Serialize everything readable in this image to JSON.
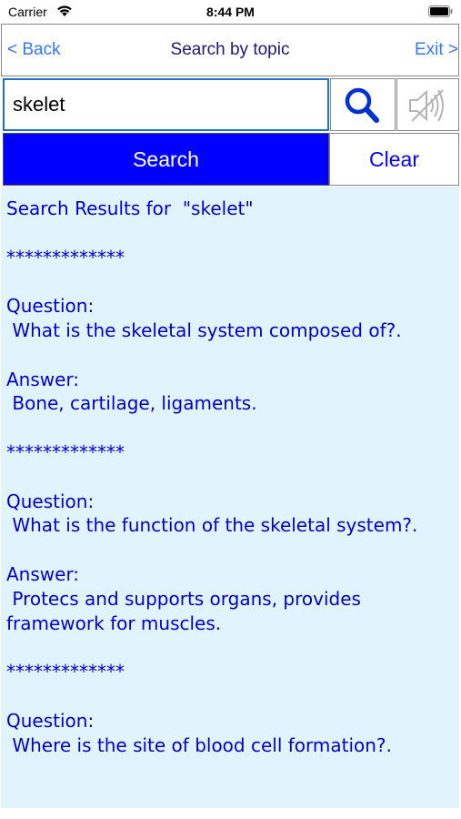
{
  "status_bar": {
    "carrier": "Carrier",
    "time": "8:44 PM",
    "wifi_icon": "wifi-icon",
    "battery_icon": "battery-icon"
  },
  "nav": {
    "back_label": "< Back",
    "title": "Search by topic",
    "exit_label": "Exit >"
  },
  "search": {
    "value": "skelet",
    "search_icon": "magnifier-icon",
    "sound_icon": "speaker-muted-icon"
  },
  "buttons": {
    "search_label": "Search",
    "clear_label": "Clear"
  },
  "results": {
    "lines": [
      "Search Results for  \"skelet\"",
      "",
      "*************",
      "",
      "Question:",
      " What is the skeletal system composed of?.",
      "",
      "Answer:",
      " Bone, cartilage, ligaments.",
      "",
      "*************",
      "",
      "Question:",
      " What is the function of the skeletal system?.",
      "",
      "Answer:",
      " Protecs and supports organs, provides framework for muscles.",
      "",
      "*************",
      "",
      "Question:",
      " Where is the site of blood cell formation?."
    ]
  },
  "colors": {
    "accent_blue": "#0000ff",
    "link_blue": "#3478f6",
    "results_bg": "#e1f3fd",
    "results_text": "#0000c8"
  }
}
